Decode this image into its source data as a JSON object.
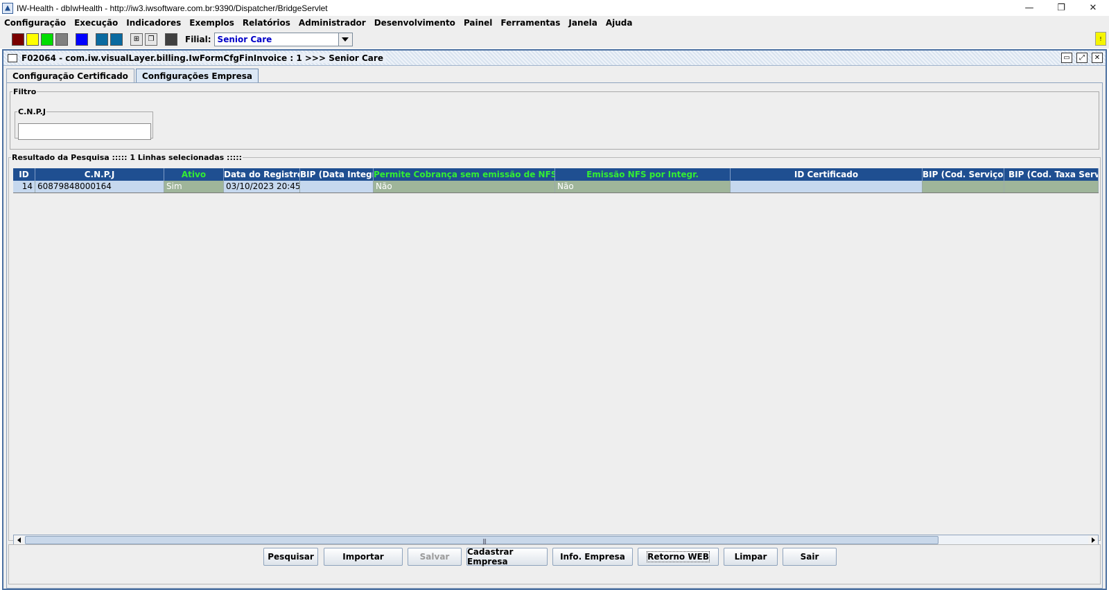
{
  "window": {
    "title": "IW-Health - dbIwHealth - http://iw3.iwsoftware.com.br:9390/Dispatcher/BridgeServlet",
    "controls": {
      "minimize": "—",
      "restore": "❐",
      "close": "✕"
    }
  },
  "menu": [
    "Configuração",
    "Execução",
    "Indicadores",
    "Exemplos",
    "Relatórios",
    "Administrador",
    "Desenvolvimento",
    "Painel",
    "Ferramentas",
    "Janela",
    "Ajuda"
  ],
  "toolbar": {
    "swatches": [
      "#7a0000",
      "#ffff00",
      "#00dd00",
      "#808080",
      "#0000ff",
      "#0a6aa0",
      "#0a6aa0",
      "#404040"
    ],
    "filial_label": "Filial:",
    "filial_value": "Senior Care",
    "notification": "!"
  },
  "frame": {
    "title": "F02064 - com.iw.visualLayer.billing.IwFormCfgFinInvoice : 1 >>> Senior Care",
    "controls": {
      "minimize": "▭",
      "maximize": "⤢",
      "close": "✕"
    }
  },
  "tabs": [
    {
      "label": "Configuração Certificado",
      "active": false
    },
    {
      "label": "Configurações Empresa",
      "active": true
    }
  ],
  "filter": {
    "legend": "Filtro",
    "cnpj_legend": "C.N.P.J",
    "cnpj_value": ""
  },
  "results": {
    "legend": "Resultado da Pesquisa ::::: 1 Linhas selecionadas :::::",
    "columns": [
      {
        "label": "ID",
        "green": false
      },
      {
        "label": "C.N.P.J",
        "green": false
      },
      {
        "label": "Ativo",
        "green": true
      },
      {
        "label": "Data do Registro",
        "green": false
      },
      {
        "label": "BIP (Data Integr)",
        "green": false
      },
      {
        "label": "Permite Cobrança sem emissão de NFS",
        "green": true
      },
      {
        "label": "Emissão NFS por Integr.",
        "green": true
      },
      {
        "label": "ID Certificado",
        "green": false
      },
      {
        "label": "BIP (Cod. Serviço)",
        "green": false
      },
      {
        "label": "BIP (Cod. Taxa Serv",
        "green": false
      }
    ],
    "rows": [
      [
        "14",
        "60879848000164",
        "Sim",
        "03/10/2023 20:45",
        "",
        "Não",
        "Não",
        "",
        "",
        ""
      ]
    ],
    "scroll_fraction": 0.86
  },
  "buttons": [
    {
      "label": "Pesquisar",
      "disabled": false
    },
    {
      "label": "Importar",
      "disabled": false
    },
    {
      "label": "Salvar",
      "disabled": true
    },
    {
      "label": "Cadastrar Empresa",
      "disabled": false
    },
    {
      "label": "Info. Empresa",
      "disabled": false
    },
    {
      "label": "Retorno WEB",
      "disabled": false
    },
    {
      "label": "Limpar",
      "disabled": false
    },
    {
      "label": "Sair",
      "disabled": false
    }
  ]
}
